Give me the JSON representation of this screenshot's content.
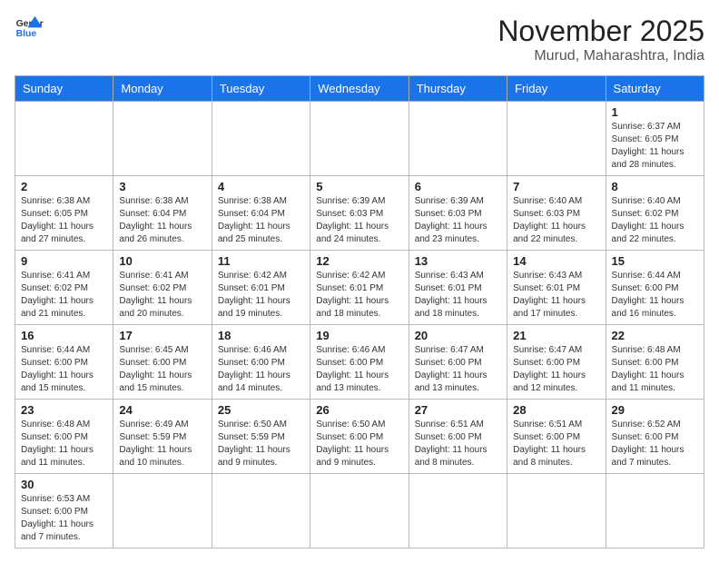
{
  "logo": {
    "text_general": "General",
    "text_blue": "Blue"
  },
  "title": "November 2025",
  "subtitle": "Murud, Maharashtra, India",
  "weekdays": [
    "Sunday",
    "Monday",
    "Tuesday",
    "Wednesday",
    "Thursday",
    "Friday",
    "Saturday"
  ],
  "weeks": [
    [
      {
        "day": "",
        "info": ""
      },
      {
        "day": "",
        "info": ""
      },
      {
        "day": "",
        "info": ""
      },
      {
        "day": "",
        "info": ""
      },
      {
        "day": "",
        "info": ""
      },
      {
        "day": "",
        "info": ""
      },
      {
        "day": "1",
        "info": "Sunrise: 6:37 AM\nSunset: 6:05 PM\nDaylight: 11 hours\nand 28 minutes."
      }
    ],
    [
      {
        "day": "2",
        "info": "Sunrise: 6:38 AM\nSunset: 6:05 PM\nDaylight: 11 hours\nand 27 minutes."
      },
      {
        "day": "3",
        "info": "Sunrise: 6:38 AM\nSunset: 6:04 PM\nDaylight: 11 hours\nand 26 minutes."
      },
      {
        "day": "4",
        "info": "Sunrise: 6:38 AM\nSunset: 6:04 PM\nDaylight: 11 hours\nand 25 minutes."
      },
      {
        "day": "5",
        "info": "Sunrise: 6:39 AM\nSunset: 6:03 PM\nDaylight: 11 hours\nand 24 minutes."
      },
      {
        "day": "6",
        "info": "Sunrise: 6:39 AM\nSunset: 6:03 PM\nDaylight: 11 hours\nand 23 minutes."
      },
      {
        "day": "7",
        "info": "Sunrise: 6:40 AM\nSunset: 6:03 PM\nDaylight: 11 hours\nand 22 minutes."
      },
      {
        "day": "8",
        "info": "Sunrise: 6:40 AM\nSunset: 6:02 PM\nDaylight: 11 hours\nand 22 minutes."
      }
    ],
    [
      {
        "day": "9",
        "info": "Sunrise: 6:41 AM\nSunset: 6:02 PM\nDaylight: 11 hours\nand 21 minutes."
      },
      {
        "day": "10",
        "info": "Sunrise: 6:41 AM\nSunset: 6:02 PM\nDaylight: 11 hours\nand 20 minutes."
      },
      {
        "day": "11",
        "info": "Sunrise: 6:42 AM\nSunset: 6:01 PM\nDaylight: 11 hours\nand 19 minutes."
      },
      {
        "day": "12",
        "info": "Sunrise: 6:42 AM\nSunset: 6:01 PM\nDaylight: 11 hours\nand 18 minutes."
      },
      {
        "day": "13",
        "info": "Sunrise: 6:43 AM\nSunset: 6:01 PM\nDaylight: 11 hours\nand 18 minutes."
      },
      {
        "day": "14",
        "info": "Sunrise: 6:43 AM\nSunset: 6:01 PM\nDaylight: 11 hours\nand 17 minutes."
      },
      {
        "day": "15",
        "info": "Sunrise: 6:44 AM\nSunset: 6:00 PM\nDaylight: 11 hours\nand 16 minutes."
      }
    ],
    [
      {
        "day": "16",
        "info": "Sunrise: 6:44 AM\nSunset: 6:00 PM\nDaylight: 11 hours\nand 15 minutes."
      },
      {
        "day": "17",
        "info": "Sunrise: 6:45 AM\nSunset: 6:00 PM\nDaylight: 11 hours\nand 15 minutes."
      },
      {
        "day": "18",
        "info": "Sunrise: 6:46 AM\nSunset: 6:00 PM\nDaylight: 11 hours\nand 14 minutes."
      },
      {
        "day": "19",
        "info": "Sunrise: 6:46 AM\nSunset: 6:00 PM\nDaylight: 11 hours\nand 13 minutes."
      },
      {
        "day": "20",
        "info": "Sunrise: 6:47 AM\nSunset: 6:00 PM\nDaylight: 11 hours\nand 13 minutes."
      },
      {
        "day": "21",
        "info": "Sunrise: 6:47 AM\nSunset: 6:00 PM\nDaylight: 11 hours\nand 12 minutes."
      },
      {
        "day": "22",
        "info": "Sunrise: 6:48 AM\nSunset: 6:00 PM\nDaylight: 11 hours\nand 11 minutes."
      }
    ],
    [
      {
        "day": "23",
        "info": "Sunrise: 6:48 AM\nSunset: 6:00 PM\nDaylight: 11 hours\nand 11 minutes."
      },
      {
        "day": "24",
        "info": "Sunrise: 6:49 AM\nSunset: 5:59 PM\nDaylight: 11 hours\nand 10 minutes."
      },
      {
        "day": "25",
        "info": "Sunrise: 6:50 AM\nSunset: 5:59 PM\nDaylight: 11 hours\nand 9 minutes."
      },
      {
        "day": "26",
        "info": "Sunrise: 6:50 AM\nSunset: 6:00 PM\nDaylight: 11 hours\nand 9 minutes."
      },
      {
        "day": "27",
        "info": "Sunrise: 6:51 AM\nSunset: 6:00 PM\nDaylight: 11 hours\nand 8 minutes."
      },
      {
        "day": "28",
        "info": "Sunrise: 6:51 AM\nSunset: 6:00 PM\nDaylight: 11 hours\nand 8 minutes."
      },
      {
        "day": "29",
        "info": "Sunrise: 6:52 AM\nSunset: 6:00 PM\nDaylight: 11 hours\nand 7 minutes."
      }
    ],
    [
      {
        "day": "30",
        "info": "Sunrise: 6:53 AM\nSunset: 6:00 PM\nDaylight: 11 hours\nand 7 minutes."
      },
      {
        "day": "",
        "info": ""
      },
      {
        "day": "",
        "info": ""
      },
      {
        "day": "",
        "info": ""
      },
      {
        "day": "",
        "info": ""
      },
      {
        "day": "",
        "info": ""
      },
      {
        "day": "",
        "info": ""
      }
    ]
  ]
}
